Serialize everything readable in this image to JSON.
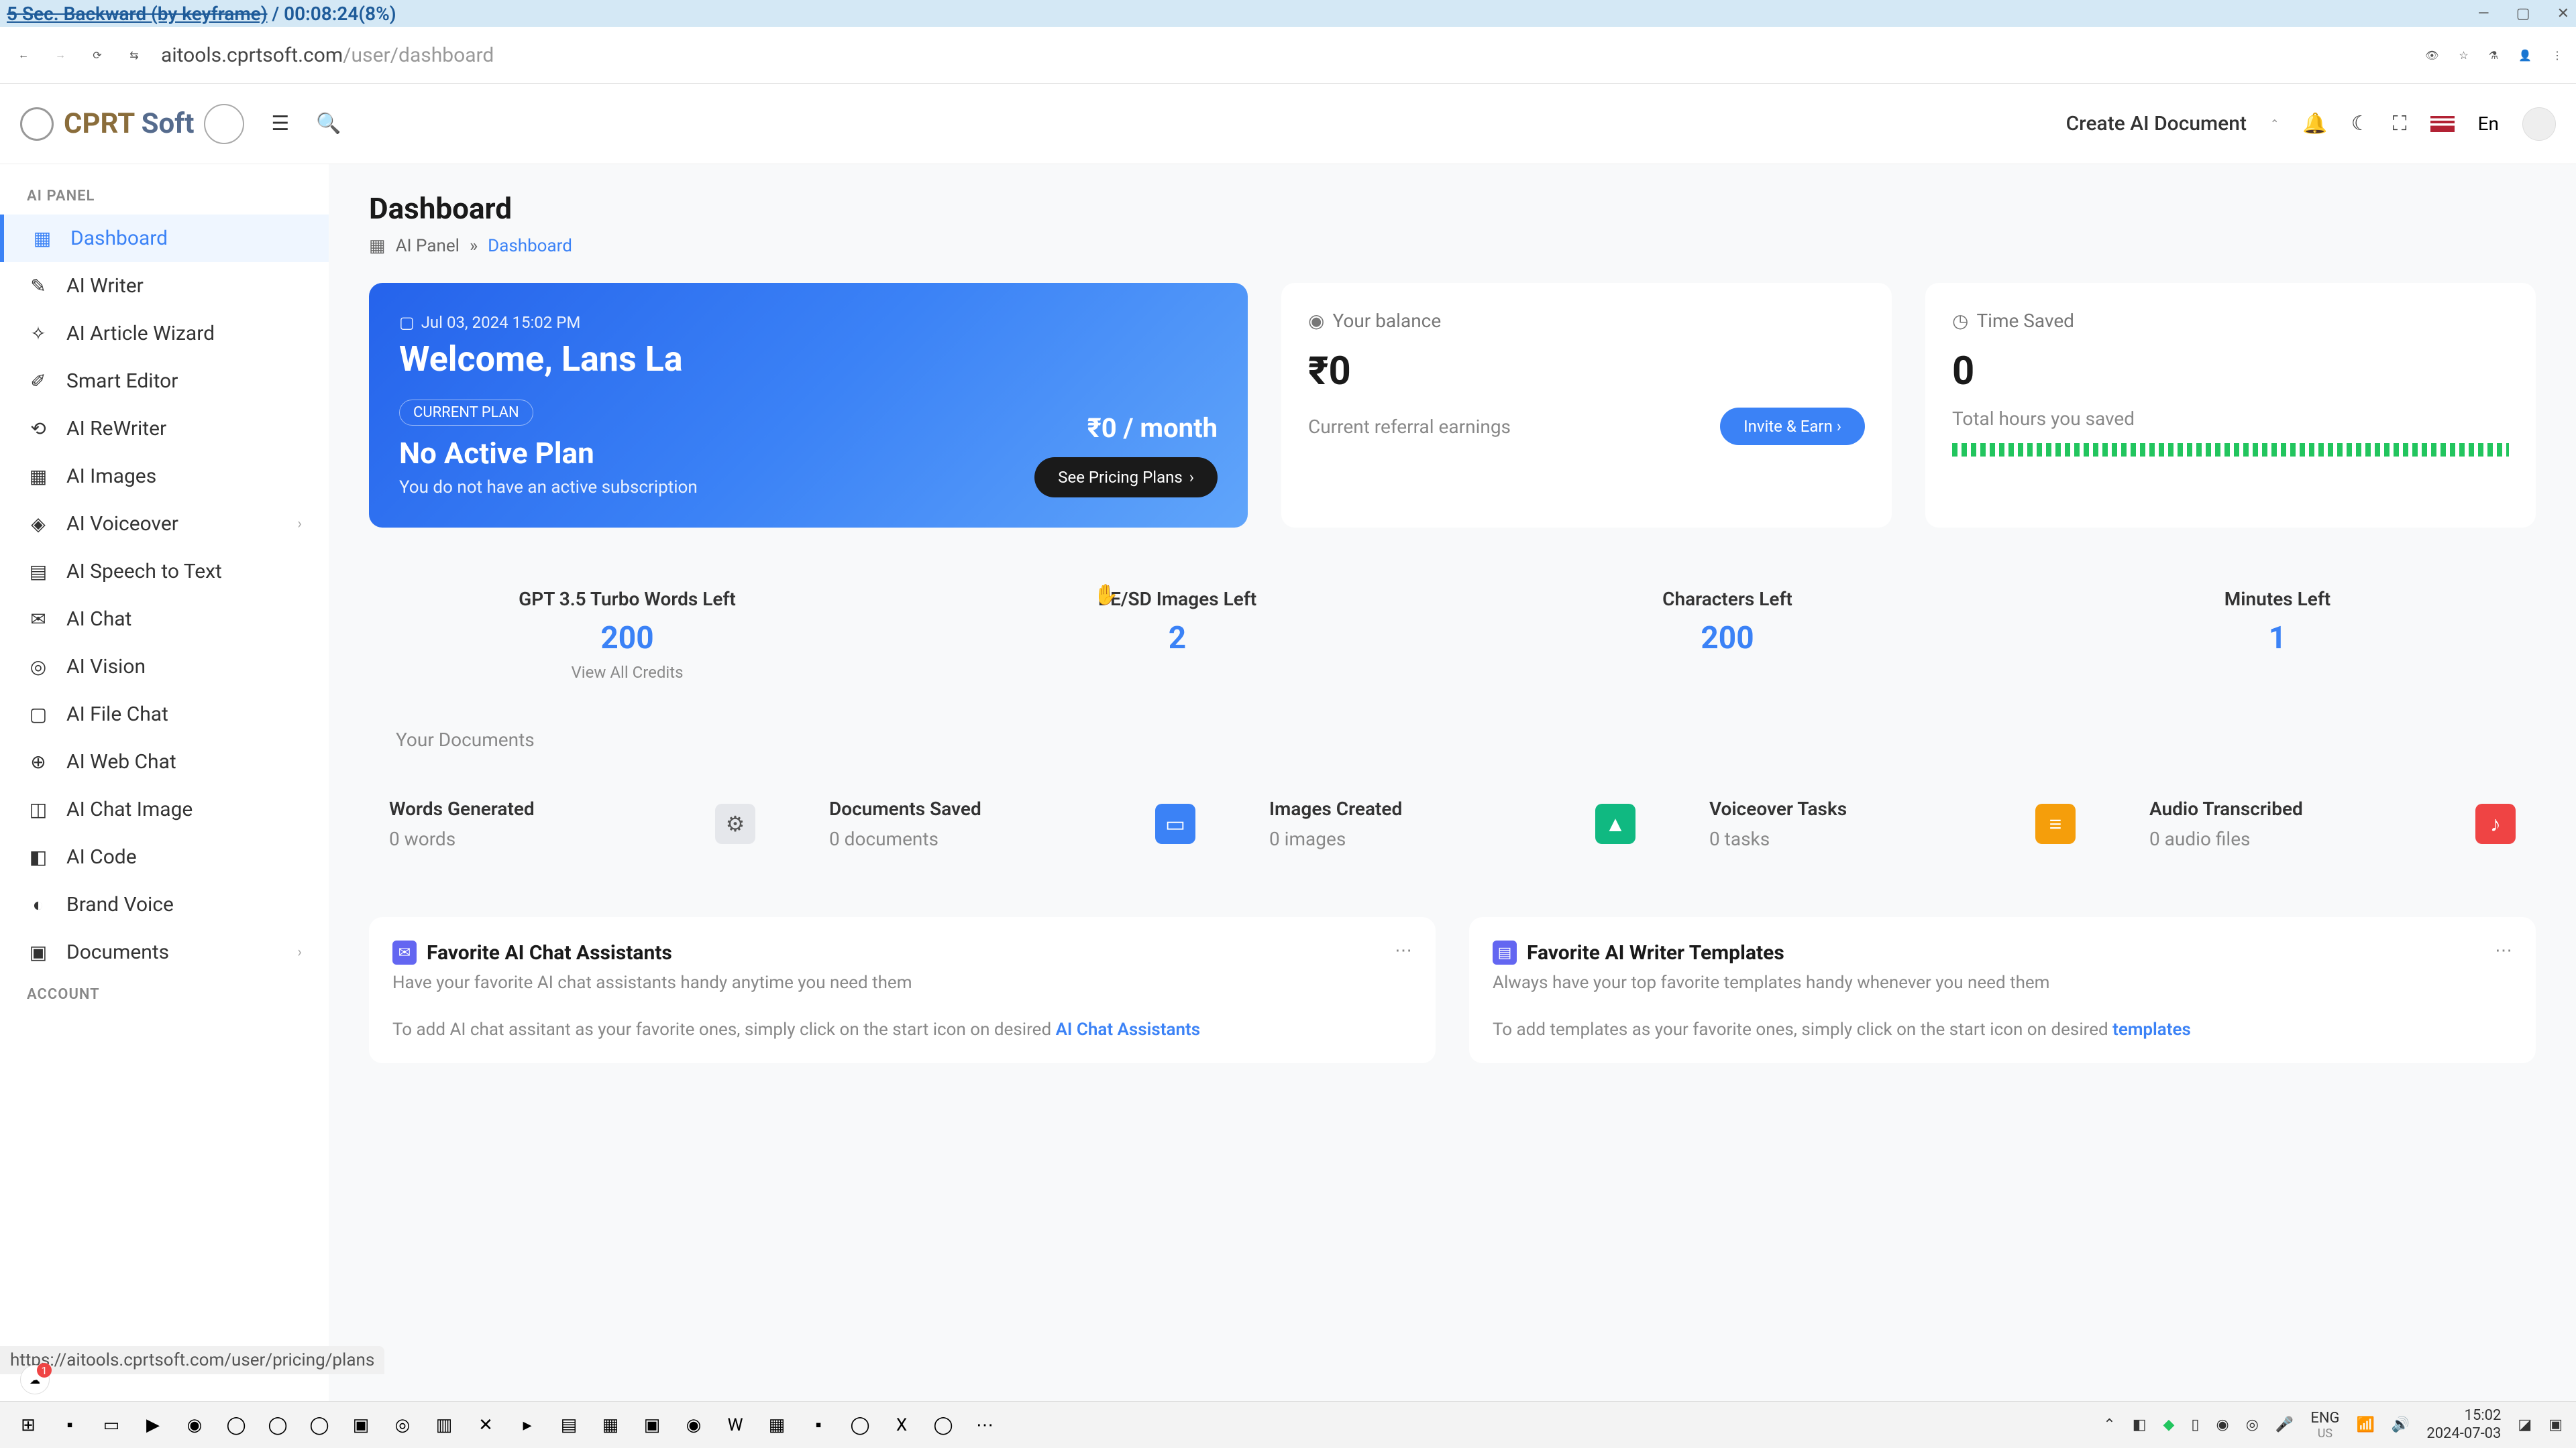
{
  "titlebar": {
    "struck": "5 Sec. Backward (by keyframe)",
    "after": " / 00:08:24(8%)"
  },
  "browser": {
    "url_host": "aitools.cprtsoft.com",
    "url_path": "/user/dashboard"
  },
  "logo": {
    "c": "CPRT",
    "s": " Soft"
  },
  "header": {
    "create": "Create AI Document",
    "lang": "En"
  },
  "sidebar": {
    "section1": "AI PANEL",
    "section2": "ACCOUNT",
    "items": [
      {
        "label": "Dashboard",
        "icon": "▦",
        "active": true
      },
      {
        "label": "AI Writer",
        "icon": "✎"
      },
      {
        "label": "AI Article Wizard",
        "icon": "✧"
      },
      {
        "label": "Smart Editor",
        "icon": "✐"
      },
      {
        "label": "AI ReWriter",
        "icon": "⟲"
      },
      {
        "label": "AI Images",
        "icon": "▦"
      },
      {
        "label": "AI Voiceover",
        "icon": "◈",
        "chevron": true
      },
      {
        "label": "AI Speech to Text",
        "icon": "▤"
      },
      {
        "label": "AI Chat",
        "icon": "✉"
      },
      {
        "label": "AI Vision",
        "icon": "◎"
      },
      {
        "label": "AI File Chat",
        "icon": "▢"
      },
      {
        "label": "AI Web Chat",
        "icon": "⊕"
      },
      {
        "label": "AI Chat Image",
        "icon": "◫"
      },
      {
        "label": "AI Code",
        "icon": "◧"
      },
      {
        "label": "Brand Voice",
        "icon": "◐"
      },
      {
        "label": "Documents",
        "icon": "▣",
        "chevron": true
      }
    ]
  },
  "page": {
    "title": "Dashboard"
  },
  "breadcrumb": {
    "root": "AI Panel",
    "sep": "»",
    "current": "Dashboard"
  },
  "welcome": {
    "date": "Jul 03, 2024 15:02 PM",
    "title": "Welcome, Lans La",
    "badge": "CURRENT PLAN",
    "plan": "No Active Plan",
    "sub": "You do not have an active subscription",
    "price": "₹0 / month",
    "btn": "See Pricing Plans"
  },
  "balance": {
    "label": "Your balance",
    "value": "₹0",
    "sub": "Current referral earnings",
    "btn": "Invite & Earn"
  },
  "time": {
    "label": "Time Saved",
    "value": "0",
    "sub": "Total hours you saved"
  },
  "credits": [
    {
      "label": "GPT 3.5 Turbo Words Left",
      "value": "200",
      "link": "View All Credits"
    },
    {
      "label": "DE/SD Images Left",
      "value": "2"
    },
    {
      "label": "Characters Left",
      "value": "200"
    },
    {
      "label": "Minutes Left",
      "value": "1"
    }
  ],
  "docs_title": "Your Documents",
  "stats": [
    {
      "label": "Words Generated",
      "value": "0 words",
      "cls": "si-ai",
      "icon": "⚙"
    },
    {
      "label": "Documents Saved",
      "value": "0 documents",
      "cls": "si-doc",
      "icon": "▭"
    },
    {
      "label": "Images Created",
      "value": "0 images",
      "cls": "si-img",
      "icon": "▲"
    },
    {
      "label": "Voiceover Tasks",
      "value": "0 tasks",
      "cls": "si-vo",
      "icon": "≡"
    },
    {
      "label": "Audio Transcribed",
      "value": "0 audio files",
      "cls": "si-au",
      "icon": "♪"
    }
  ],
  "fav": [
    {
      "title": "Favorite AI Chat Assistants",
      "sub": "Have your favorite AI chat assistants handy anytime you need them",
      "hint": "To add AI chat assitant as your favorite ones, simply click on the start icon on desired ",
      "link": "AI Chat Assistants",
      "cls": "fi-chat",
      "icon": "✉"
    },
    {
      "title": "Favorite AI Writer Templates",
      "sub": "Always have your top favorite templates handy whenever you need them",
      "hint": "To add templates as your favorite ones, simply click on the start icon on desired ",
      "link": "templates",
      "cls": "fi-tpl",
      "icon": "▤"
    }
  ],
  "status_url": "https://aitools.cprtsoft.com/user/pricing/plans",
  "taskbar": {
    "lang": "ENG",
    "region": "US",
    "time": "15:02",
    "date": "2024-07-03",
    "icons": [
      "⊞",
      "▪",
      "▭",
      "▶",
      "◉",
      "◯",
      "◯",
      "◯",
      "▣",
      "◎",
      "▥",
      "✕",
      "▸",
      "▤",
      "▦",
      "▣",
      "◉",
      "W",
      "▦",
      "▪",
      "◯",
      "X",
      "◯",
      "⋯"
    ]
  }
}
